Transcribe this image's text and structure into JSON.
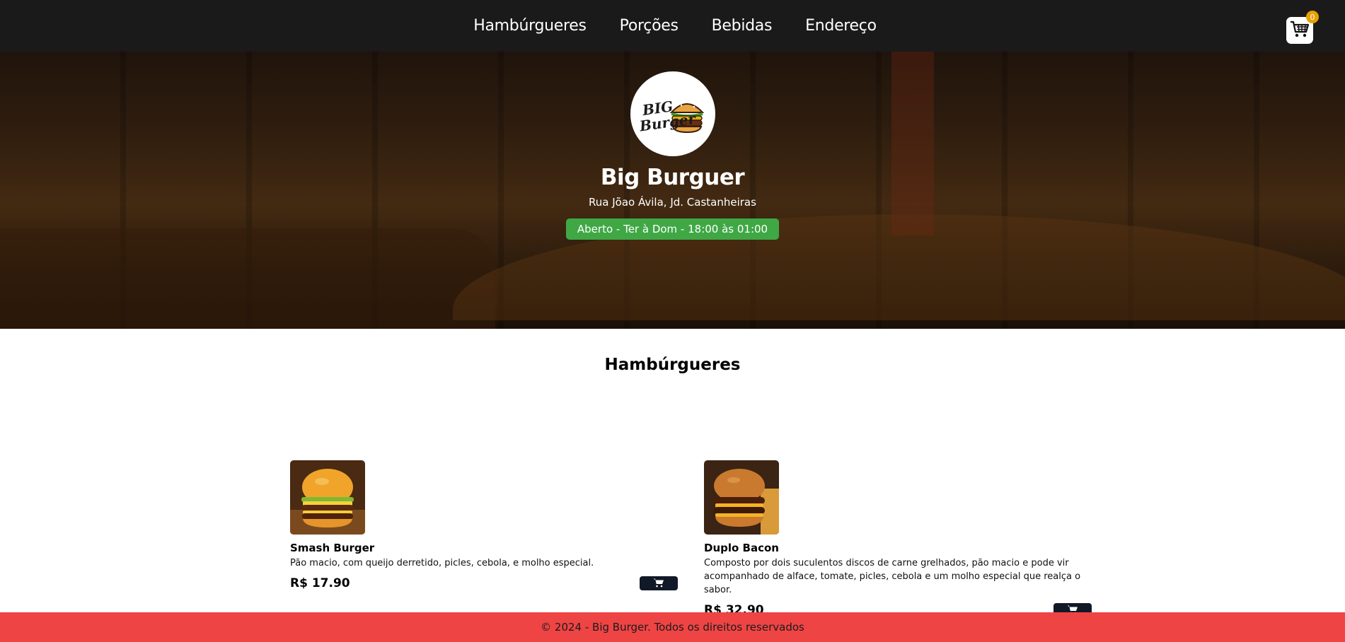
{
  "nav": {
    "links": [
      "Hambúrgueres",
      "Porções",
      "Bebidas",
      "Endereço"
    ],
    "cart_count": "0"
  },
  "hero": {
    "title": "Big Burguer",
    "address": "Rua Jõao Ávila, Jd. Castanheiras",
    "hours": "Aberto - Ter à Dom - 18:00 às 01:00"
  },
  "menu": {
    "section_title": "Hambúrgueres",
    "items": [
      {
        "name": "Smash Burger",
        "description": "Pão macio, com queijo derretido, picles, cebola, e molho especial.",
        "price": "R$ 17.90"
      },
      {
        "name": "Duplo Bacon",
        "description": "Composto por dois suculentos discos de carne grelhados, pão macio e pode vir acompanhado de alface, tomate, picles, cebola e um molho especial que realça o sabor.",
        "price": "R$ 32.90"
      }
    ]
  },
  "footer": {
    "text": "© 2024 - Big Burger. Todos os direitos reservados"
  },
  "colors": {
    "nav_bg": "#1b1a1a",
    "hours_badge": "#3fa845",
    "cart_badge": "#e6a100",
    "add_button": "#111827",
    "footer_bg": "#ef4444"
  },
  "icons": {
    "cart": "shopping-cart-icon",
    "add_to_cart": "shopping-cart-icon",
    "logo": "burger-logo"
  }
}
